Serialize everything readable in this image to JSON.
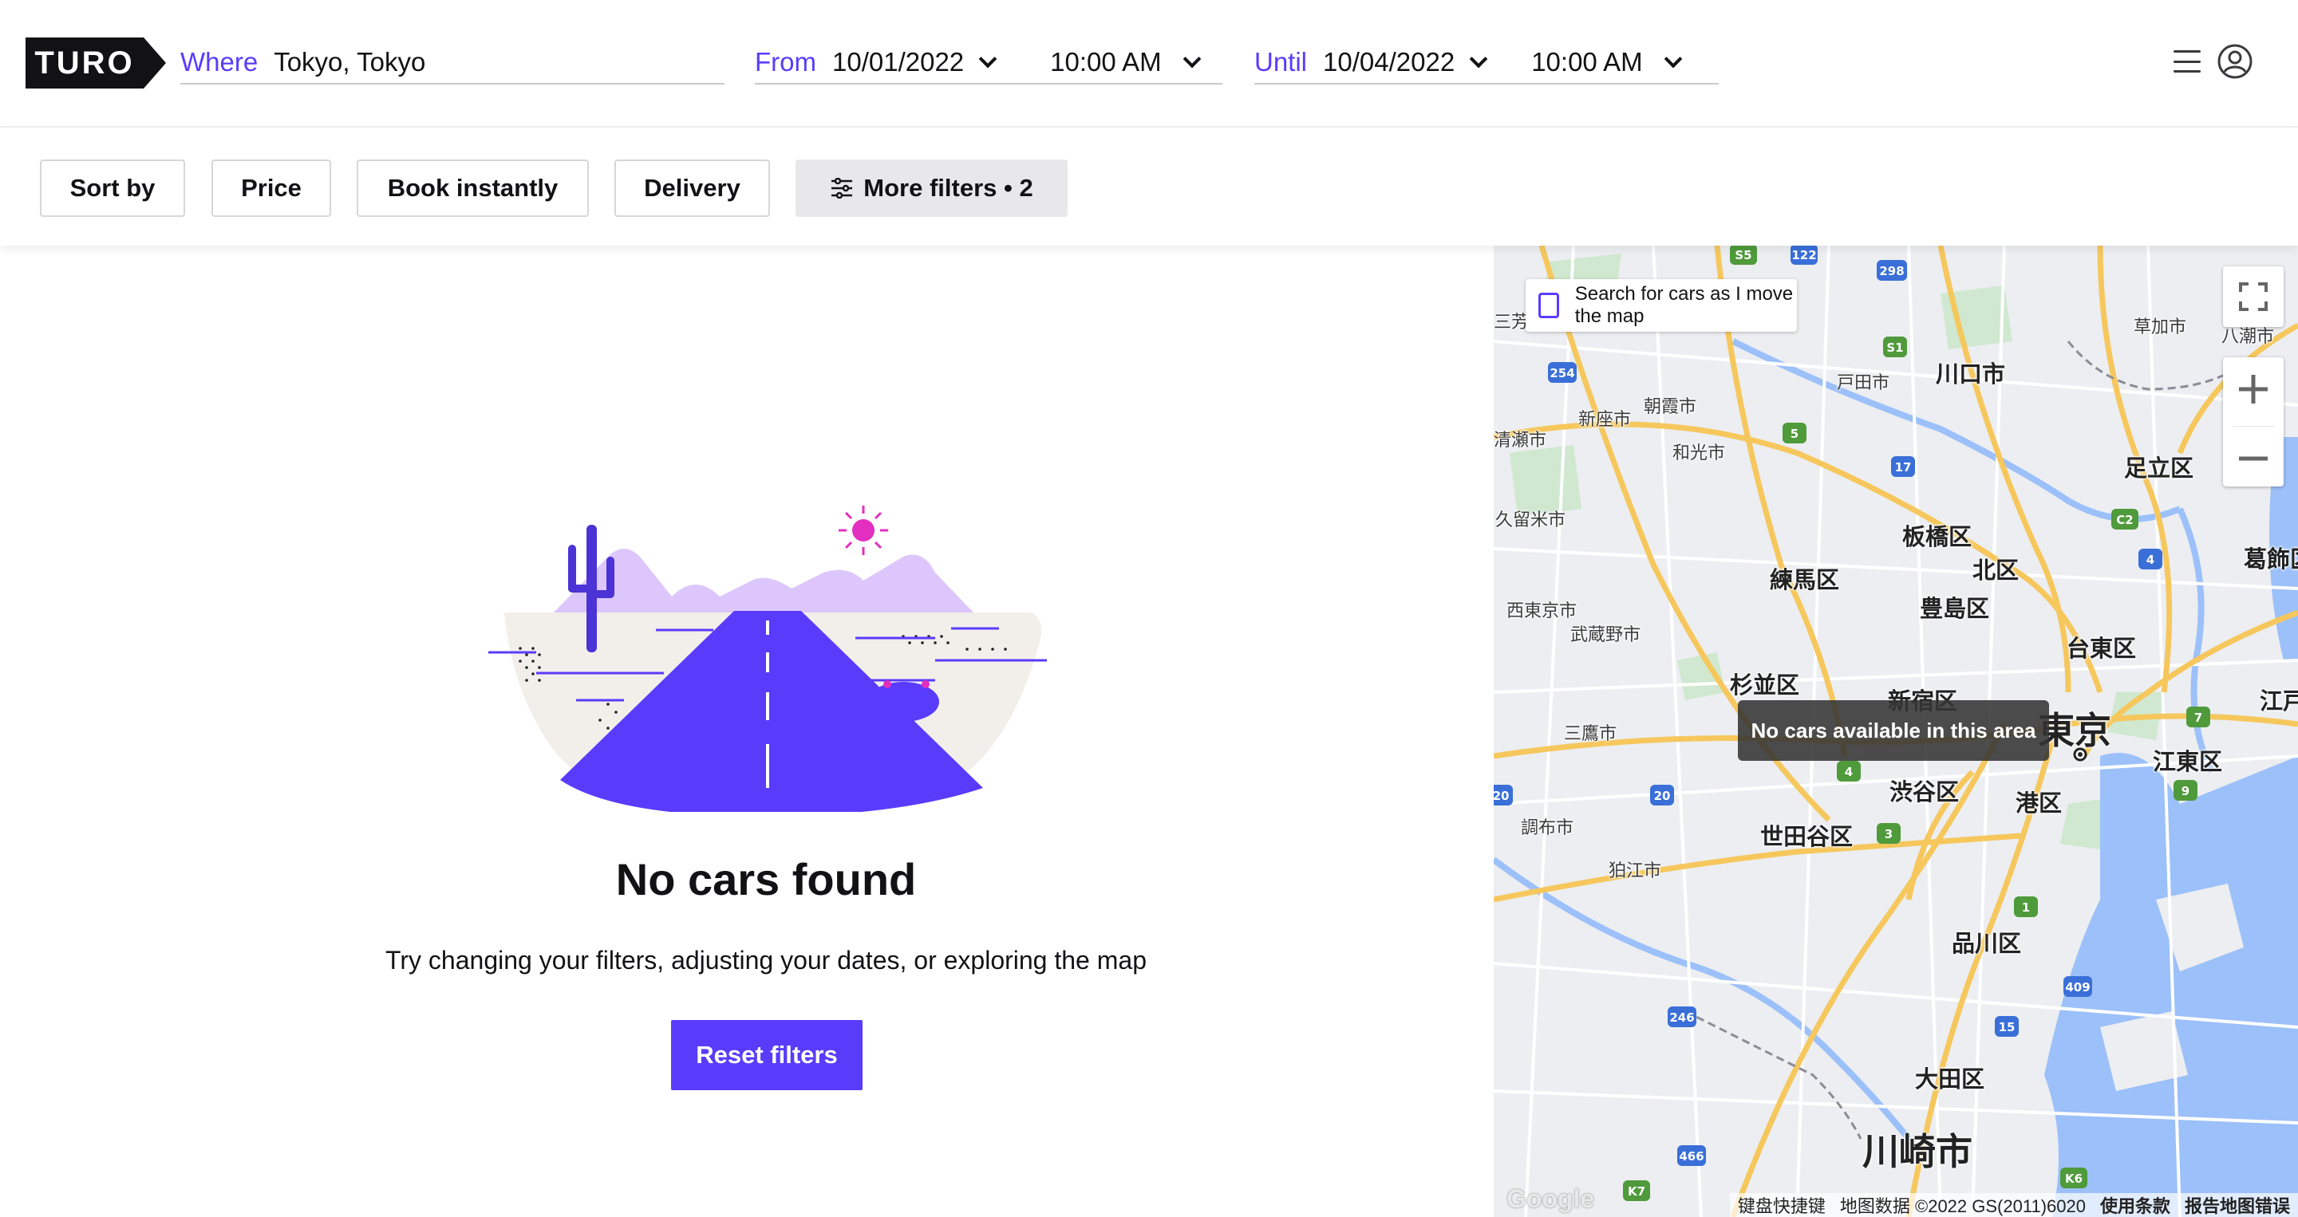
{
  "brand": "TURO",
  "search": {
    "where_label": "Where",
    "where_value": "Tokyo, Tokyo",
    "from_label": "From",
    "from_date": "10/01/2022",
    "from_time": "10:00 AM",
    "until_label": "Until",
    "until_date": "10/04/2022",
    "until_time": "10:00 AM"
  },
  "filters": {
    "sort": "Sort by",
    "price": "Price",
    "book_instantly": "Book instantly",
    "delivery": "Delivery",
    "more_filters": "More filters • 2"
  },
  "empty_state": {
    "title": "No cars found",
    "subtitle": "Try changing your filters, adjusting your dates, or exploring the map",
    "reset_label": "Reset filters"
  },
  "map": {
    "search_as_move": "Search for cars as I move the map",
    "tooltip": "No cars available in this area",
    "labels": {
      "kawaguchi": "川口市",
      "toda": "戸田市",
      "soka": "草加市",
      "yashio": "八潮市",
      "asaka": "朝霞市",
      "niiza": "新座市",
      "wako": "和光市",
      "kiyose": "清瀬市",
      "adachi": "足立区",
      "kurume": "久留米市",
      "itabashi": "板橋区",
      "kita": "北区",
      "katsushika": "葛飾区",
      "nerima": "練馬区",
      "toshima": "豊島区",
      "nishitokyo": "西東京市",
      "musashino": "武蔵野市",
      "taito": "台東区",
      "suginami": "杉並区",
      "shinjuku": "新宿区",
      "tokyo": "東京",
      "edogawa": "江戸",
      "mitaka": "三鷹市",
      "koto": "江東区",
      "shibuya": "渋谷区",
      "minato": "港区",
      "chofu": "調布市",
      "setagaya": "世田谷区",
      "komae": "狛江市",
      "shinagawa": "品川区",
      "ota": "大田区",
      "kawasaki": "川崎市",
      "sanhou": "三芳"
    },
    "attribution": {
      "shortcuts": "键盘快捷键",
      "data": "地图数据 ©2022 GS(2011)6020",
      "terms": "使用条款",
      "report": "报告地图错误",
      "google": "Google"
    }
  },
  "colors": {
    "accent": "#593cfb",
    "map_water": "#9cc0f9",
    "map_road": "#f6c75c"
  }
}
